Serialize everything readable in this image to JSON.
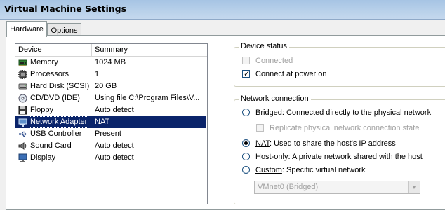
{
  "window": {
    "title": "Virtual Machine Settings"
  },
  "tabs": [
    {
      "label": "Hardware",
      "active": true
    },
    {
      "label": "Options",
      "active": false
    }
  ],
  "device_list": {
    "columns": [
      "Device",
      "Summary"
    ],
    "rows": [
      {
        "icon": "memory-icon",
        "device": "Memory",
        "summary": "1024 MB",
        "selected": false
      },
      {
        "icon": "processor-icon",
        "device": "Processors",
        "summary": "1",
        "selected": false
      },
      {
        "icon": "hard-disk-icon",
        "device": "Hard Disk (SCSI)",
        "summary": "20 GB",
        "selected": false
      },
      {
        "icon": "cd-dvd-icon",
        "device": "CD/DVD (IDE)",
        "summary": "Using file C:\\Program Files\\V...",
        "selected": false
      },
      {
        "icon": "floppy-icon",
        "device": "Floppy",
        "summary": "Auto detect",
        "selected": false
      },
      {
        "icon": "network-adapter-icon",
        "device": "Network Adapter",
        "summary": "NAT",
        "selected": true
      },
      {
        "icon": "usb-icon",
        "device": "USB Controller",
        "summary": "Present",
        "selected": false
      },
      {
        "icon": "sound-card-icon",
        "device": "Sound Card",
        "summary": "Auto detect",
        "selected": false
      },
      {
        "icon": "display-icon",
        "device": "Display",
        "summary": "Auto detect",
        "selected": false
      }
    ]
  },
  "device_status": {
    "title": "Device status",
    "connected": {
      "label": "Connected",
      "checked": false,
      "enabled": false
    },
    "connect_at_power_on": {
      "label": "Connect at power on",
      "checked": true,
      "enabled": true
    }
  },
  "network_connection": {
    "title": "Network connection",
    "bridged": {
      "label_key": "Bridged",
      "label_rest": ": Connected directly to the physical network",
      "selected": false
    },
    "replicate": {
      "label": "Replicate physical network connection state",
      "checked": false,
      "enabled": false
    },
    "nat": {
      "label_key": "NAT",
      "label_rest": ": Used to share the host's IP address",
      "selected": true
    },
    "host_only": {
      "label_key": "Host-only",
      "label_rest": ": A private network shared with the host",
      "selected": false
    },
    "custom": {
      "label_key": "Custom",
      "label_rest": ": Specific virtual network",
      "selected": false
    },
    "vmnet_select": {
      "value": "VMnet0 (Bridged)",
      "enabled": false
    }
  },
  "colors": {
    "selection": "#0a246a",
    "title_gradient": "#b9d1ea"
  }
}
